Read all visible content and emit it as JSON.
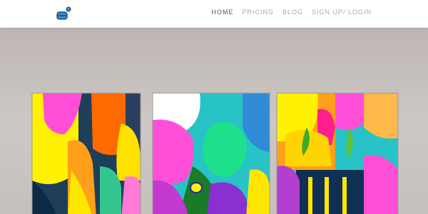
{
  "header": {
    "logo_icon": "app-logo-icon",
    "nav": [
      {
        "label": "HOME",
        "active": true
      },
      {
        "label": "PRICING",
        "active": false
      },
      {
        "label": "BLOG",
        "active": false
      },
      {
        "label": "SIGN UP/ LOGIN",
        "active": false
      }
    ]
  },
  "colors": {
    "wall": "#c9c4c1",
    "nav_active": "#555555",
    "nav_inactive": "#a7a7a7",
    "logo_blue": "#2f8fe0",
    "logo_dark": "#1f3a5a"
  }
}
